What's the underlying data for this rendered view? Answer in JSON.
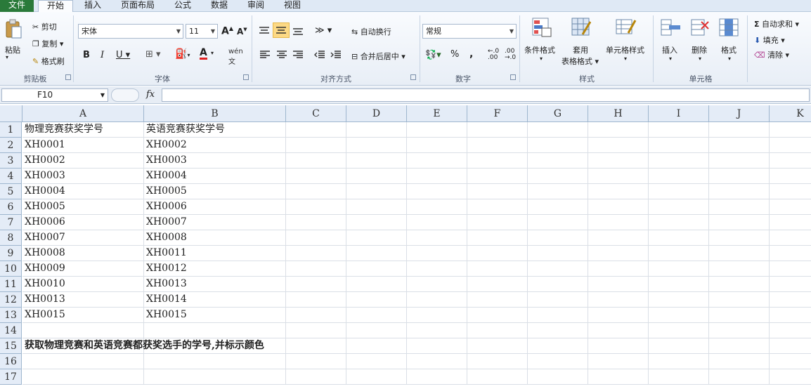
{
  "menu_tabs": [
    "文件",
    "开始",
    "插入",
    "页面布局",
    "公式",
    "数据",
    "审阅",
    "视图"
  ],
  "ribbon": {
    "clipboard": {
      "paste": "粘贴",
      "cut": "剪切",
      "copy": "复制",
      "format_painter": "格式刷",
      "label": "剪贴板"
    },
    "font": {
      "name": "宋体",
      "size": "11",
      "label": "字体",
      "bold": "B",
      "italic": "I",
      "underline": "U",
      "font_color": "A"
    },
    "alignment": {
      "wrap": "自动换行",
      "merge": "合并后居中",
      "label": "对齐方式"
    },
    "number": {
      "format": "常规",
      "percent": "%",
      "comma": ",",
      "label": "数字"
    },
    "styles": {
      "conditional": "条件格式",
      "table_line1": "套用",
      "table_line2": "表格格式",
      "cell_styles": "单元格样式",
      "label": "样式"
    },
    "cells": {
      "insert": "插入",
      "delete": "删除",
      "format": "格式",
      "label": "单元格"
    },
    "editing": {
      "autosum": "自动求和",
      "fill": "填充",
      "clear": "清除"
    }
  },
  "formula_bar": {
    "name_box": "F10",
    "fx": "fx",
    "formula": ""
  },
  "columns": [
    "A",
    "B",
    "C",
    "D",
    "E",
    "F",
    "G",
    "H",
    "I",
    "J",
    "K"
  ],
  "rows": [
    "1",
    "2",
    "3",
    "4",
    "5",
    "6",
    "7",
    "8",
    "9",
    "10",
    "11",
    "12",
    "13",
    "14",
    "15",
    "16",
    "17"
  ],
  "cells": {
    "A1": "物理竞赛获奖学号",
    "B1": "英语竞赛获奖学号",
    "A2": "XH0001",
    "B2": "XH0002",
    "A3": "XH0002",
    "B3": "XH0003",
    "A4": "XH0003",
    "B4": "XH0004",
    "A5": "XH0004",
    "B5": "XH0005",
    "A6": "XH0005",
    "B6": "XH0006",
    "A7": "XH0006",
    "B7": "XH0007",
    "A8": "XH0007",
    "B8": "XH0008",
    "A9": "XH0008",
    "B9": "XH0011",
    "A10": "XH0009",
    "B10": "XH0012",
    "A11": "XH0010",
    "B11": "XH0013",
    "A12": "XH0013",
    "B12": "XH0014",
    "A13": "XH0015",
    "B13": "XH0015",
    "A15": "获取物理竞赛和英语竞赛都获奖选手的学号,并标示颜色"
  },
  "colors": {
    "file_tab": "#2a7a3a",
    "header_bg": "#e4ecf7"
  }
}
